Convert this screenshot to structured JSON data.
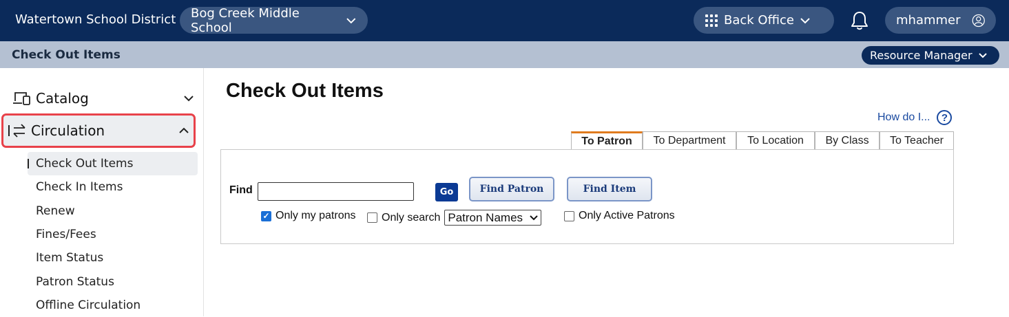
{
  "topbar": {
    "district": "Watertown School District",
    "school": "Bog Creek Middle School",
    "back_office": "Back Office",
    "user": "mhammer"
  },
  "subbar": {
    "title": "Check Out Items",
    "resource_manager": "Resource Manager"
  },
  "sidebar": {
    "catalog": "Catalog",
    "circulation": "Circulation",
    "items": [
      {
        "label": "Check Out Items"
      },
      {
        "label": "Check In Items"
      },
      {
        "label": "Renew"
      },
      {
        "label": "Fines/Fees"
      },
      {
        "label": "Item Status"
      },
      {
        "label": "Patron Status"
      },
      {
        "label": "Offline Circulation"
      }
    ]
  },
  "main": {
    "title": "Check Out Items",
    "how_do_i": "How do I...",
    "help_glyph": "?",
    "tabs": [
      {
        "label": "To Patron"
      },
      {
        "label": "To Department"
      },
      {
        "label": "To Location"
      },
      {
        "label": "By Class"
      },
      {
        "label": "To Teacher"
      }
    ],
    "find_label": "Find",
    "find_value": "",
    "go_label": "Go",
    "find_patron_label": "Find Patron",
    "find_item_label": "Find Item",
    "only_my_patrons": "Only my patrons",
    "only_search": "Only search",
    "search_select_value": "Patron Names",
    "only_active_patrons": "Only Active Patrons"
  },
  "colors": {
    "topbar": "#0b2a5a",
    "subbar": "#b4c0d2",
    "active_tab_accent": "#e07b1e",
    "highlight_outline": "#e8424a"
  }
}
